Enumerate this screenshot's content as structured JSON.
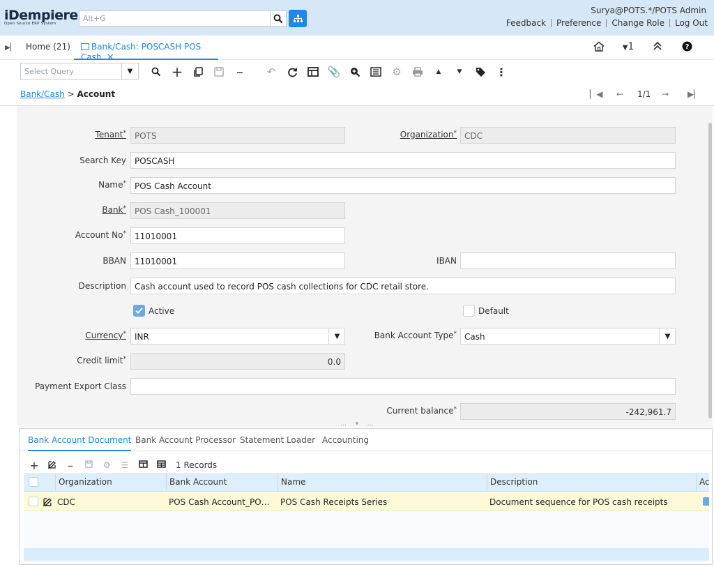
{
  "header": {
    "logo_text": "iDempiere",
    "logo_sub": "Open Source ERP System",
    "search_placeholder": "Alt+G",
    "user": "Surya@POTS.*/POTS Admin",
    "links": [
      "Feedback",
      "Preference",
      "Change Role",
      "Log Out"
    ]
  },
  "tabs": {
    "home": "Home (21)",
    "active": "Bank/Cash: POSCASH POS Cash",
    "close": "×",
    "counter": "1"
  },
  "toolbar": {
    "query_placeholder": "Select Query"
  },
  "breadcrumb": {
    "parent": "Bank/Cash",
    "separator": ">",
    "current": "Account"
  },
  "navigation": {
    "record": "1/1"
  },
  "form": {
    "tenant": {
      "label": "Tenant",
      "value": "POTS"
    },
    "organization": {
      "label": "Organization",
      "value": "CDC"
    },
    "search_key": {
      "label": "Search Key",
      "value": "POSCASH"
    },
    "name": {
      "label": "Name",
      "value": "POS Cash Account"
    },
    "bank": {
      "label": "Bank",
      "value": "POS Cash_100001"
    },
    "account_no": {
      "label": "Account No",
      "value": "11010001"
    },
    "bban": {
      "label": "BBAN",
      "value": "11010001"
    },
    "iban": {
      "label": "IBAN",
      "value": ""
    },
    "description": {
      "label": "Description",
      "value": "Cash account used to record POS cash collections for CDC retail store."
    },
    "active": {
      "label": "Active",
      "checked": true
    },
    "default": {
      "label": "Default",
      "checked": false
    },
    "currency": {
      "label": "Currency",
      "value": "INR"
    },
    "bank_account_type": {
      "label": "Bank Account Type",
      "value": "Cash"
    },
    "credit_limit": {
      "label": "Credit limit",
      "value": "0.0"
    },
    "payment_export_class": {
      "label": "Payment Export Class",
      "value": ""
    },
    "current_balance": {
      "label": "Current balance",
      "value": "-242,961.7"
    },
    "required_mark": "*"
  },
  "detail": {
    "tabs": [
      "Bank Account Document",
      "Bank Account Processor",
      "Statement Loader",
      "Accounting"
    ],
    "records": "1 Records",
    "columns": [
      "Organization",
      "Bank Account",
      "Name",
      "Description",
      "Ac"
    ],
    "rows": [
      {
        "organization": "CDC",
        "bank_account": "POS Cash Account_POS Cas...",
        "name": "POS Cash Receipts Series",
        "description": "Document sequence for POS cash receipts"
      }
    ]
  },
  "colors": {
    "accent": "#1e88e5",
    "header_bg": "#d6e8f7",
    "row_highlight": "#fdfbd7"
  }
}
